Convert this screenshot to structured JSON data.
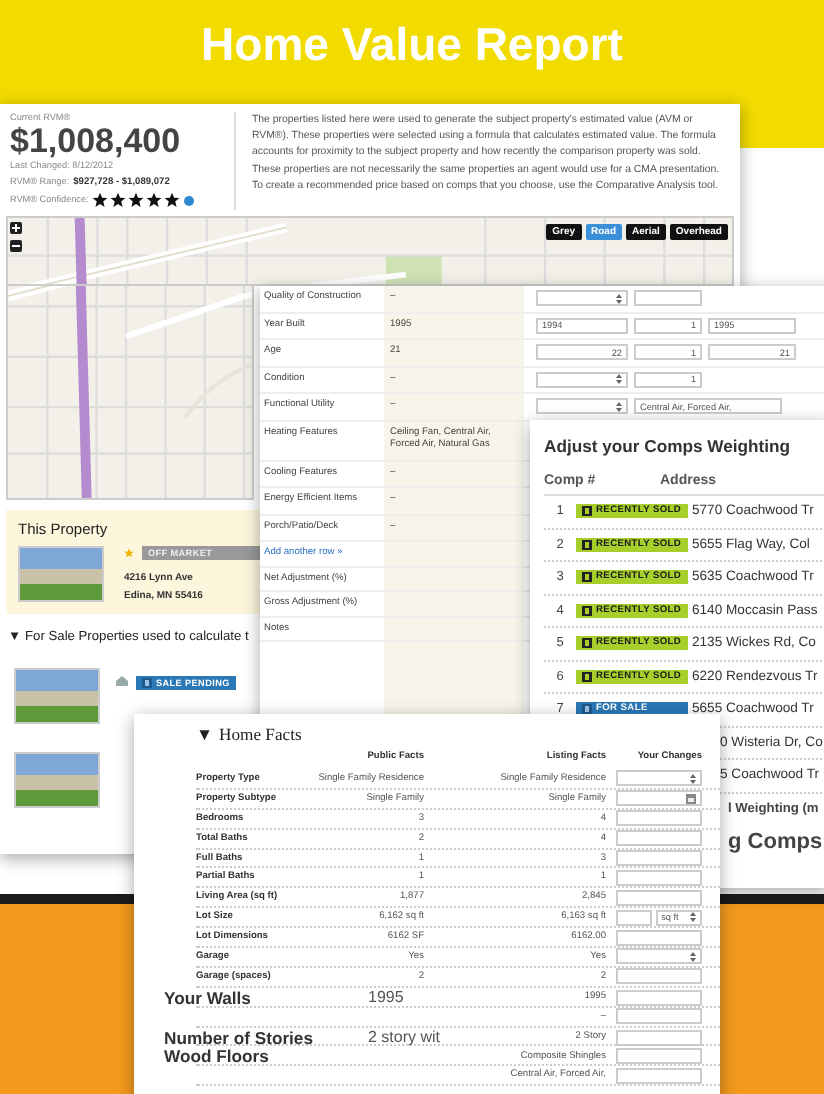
{
  "header": {
    "title": "Home Value Report"
  },
  "rvm_panel": {
    "label": "Current RVM®",
    "value": "$1,008,400",
    "last_changed": "Last Changed: 8/12/2012",
    "range_label": "RVM® Range:",
    "range": "$927,728 - $1,089,072",
    "confidence_label": "RVM® Confidence:",
    "stars": 5,
    "description": "The properties listed here were used to generate the subject property's estimated value (AVM or RVM®). These properties were selected using a formula that calculates estimated value. The formula accounts for proximity to the subject property and how recently the comparison property was sold. These properties are not necessarily the same properties an agent would use for a CMA presentation. To create a recommended price based on comps that you choose, use the Comparative Analysis tool.",
    "map_buttons": [
      {
        "label": "Grey",
        "selected": false
      },
      {
        "label": "Road",
        "selected": true
      },
      {
        "label": "Aerial",
        "selected": false
      },
      {
        "label": "Overhead",
        "selected": false
      }
    ],
    "this_property": {
      "title": "This Property",
      "status": "OFF MARKET",
      "address_line1": "4216 Lynn Ave",
      "address_line2": "Edina, MN 55416"
    },
    "for_sale_heading": {
      "arrow": "▼",
      "text": "For Sale Properties used to calculate t"
    },
    "listings": [
      {
        "kind": "with_status",
        "status": "SALE PENDING"
      },
      {
        "kind": "photo_only"
      }
    ]
  },
  "adjustments": {
    "rows": [
      {
        "label": "Quality of Construction",
        "value": "–",
        "comps": [
          {
            "kind": "select"
          },
          {
            "kind": "input"
          }
        ]
      },
      {
        "label": "Year Built",
        "value": "1995",
        "comps": [
          {
            "kind": "input",
            "value": "1994"
          },
          {
            "kind": "input",
            "value": "1"
          },
          {
            "kind": "input",
            "value": "1995"
          }
        ]
      },
      {
        "label": "Age",
        "value": "21",
        "comps": [
          {
            "kind": "input",
            "value": "22"
          },
          {
            "kind": "input",
            "value": "1"
          },
          {
            "kind": "input",
            "value": "21"
          }
        ]
      },
      {
        "label": "Condition",
        "value": "–",
        "comps": [
          {
            "kind": "select"
          },
          {
            "kind": "input",
            "value": "1"
          }
        ]
      },
      {
        "label": "Functional Utility",
        "value": "–",
        "comps": [
          {
            "kind": "select"
          },
          {
            "kind": "input",
            "value": "Central Air, Forced Air,"
          }
        ]
      },
      {
        "label": "Heating Features",
        "value": "Ceiling Fan, Central Air, Forced Air, Natural Gas"
      },
      {
        "label": "Cooling Features",
        "value": "–"
      },
      {
        "label": "Energy Efficient Items",
        "value": "–"
      },
      {
        "label": "Porch/Patio/Deck",
        "value": "–"
      }
    ],
    "add_row": "Add another row »",
    "summary_rows": [
      "Net Adjustment (%)",
      "Gross Adjustment (%)",
      "Notes"
    ]
  },
  "comps_weighting": {
    "title": "Adjust your Comps Weighting",
    "columns": [
      "Comp #",
      "Address"
    ],
    "rows": [
      {
        "kind": "recently_sold",
        "number": "1",
        "status": "RECENTLY SOLD",
        "address": "5770 Coachwood Tr"
      },
      {
        "kind": "recently_sold",
        "number": "2",
        "status": "RECENTLY SOLD",
        "address": "5655 Flag Way, Col"
      },
      {
        "kind": "recently_sold",
        "number": "3",
        "status": "RECENTLY SOLD",
        "address": "5635 Coachwood Tr"
      },
      {
        "kind": "recently_sold",
        "number": "4",
        "status": "RECENTLY SOLD",
        "address": "6140 Moccasin Pass"
      },
      {
        "kind": "recently_sold",
        "number": "5",
        "status": "RECENTLY SOLD",
        "address": "2135 Wickes Rd, Co"
      },
      {
        "kind": "recently_sold",
        "number": "6",
        "status": "RECENTLY SOLD",
        "address": "6220 Rendezvous Tr"
      },
      {
        "kind": "for_sale",
        "number": "7",
        "status": "FOR SALE",
        "address": "5655 Coachwood Tr"
      },
      {
        "kind": "partial",
        "address": "0 Wisteria Dr, Co"
      },
      {
        "kind": "partial",
        "address": "5 Coachwood Tr"
      }
    ],
    "footer_label": "l Weighting (m",
    "footer_title": "g Comps"
  },
  "home_facts": {
    "arrow": "▼",
    "title": "Home Facts",
    "columns": [
      "Public Facts",
      "Listing Facts",
      "Your Changes"
    ],
    "rows": [
      {
        "kind": "normal",
        "label": "Property Type",
        "public": "Single Family Residence",
        "listing": "Single Family Residence",
        "change": {
          "kind": "select"
        }
      },
      {
        "kind": "normal",
        "label": "Property Subtype",
        "public": "Single Family",
        "listing": "Single Family",
        "change": {
          "kind": "picker"
        }
      },
      {
        "kind": "normal",
        "label": "Bedrooms",
        "public": "3",
        "listing": "4",
        "change": {
          "kind": "input"
        }
      },
      {
        "kind": "normal",
        "label": "Total Baths",
        "public": "2",
        "listing": "4",
        "change": {
          "kind": "input"
        }
      },
      {
        "kind": "normal",
        "label": "Full Baths",
        "public": "1",
        "listing": "3",
        "change": {
          "kind": "input"
        }
      },
      {
        "kind": "normal",
        "label": "Partial Baths",
        "public": "1",
        "listing": "1",
        "change": {
          "kind": "input"
        }
      },
      {
        "kind": "normal",
        "label": "Living Area (sq ft)",
        "public": "1,877",
        "listing": "2,845",
        "change": {
          "kind": "input"
        }
      },
      {
        "kind": "normal",
        "label": "Lot Size",
        "public": "6,162 sq ft",
        "listing": "6,163 sq ft",
        "change": {
          "kind": "unit",
          "unit": "sq ft"
        }
      },
      {
        "kind": "normal",
        "label": "Lot Dimensions",
        "public": "6162 SF",
        "listing": "6162.00",
        "change": {
          "kind": "input"
        }
      },
      {
        "kind": "normal",
        "label": "Garage",
        "public": "Yes",
        "listing": "Yes",
        "change": {
          "kind": "select"
        }
      },
      {
        "kind": "normal",
        "label": "Garage (spaces)",
        "public": "2",
        "listing": "2",
        "change": {
          "kind": "input"
        }
      },
      {
        "kind": "large",
        "label": "Your Walls",
        "public": "1995",
        "listing": "1995",
        "change": {
          "kind": "input"
        }
      },
      {
        "kind": "large",
        "listing": "–",
        "change": {
          "kind": "input"
        }
      },
      {
        "kind": "large",
        "label": "Number of Stories",
        "public": "2 story wit",
        "listing": "2 Story",
        "change": {
          "kind": "input"
        }
      },
      {
        "kind": "large",
        "label": "Wood Floors",
        "listing": "Composite Shingles",
        "change": {
          "kind": "input"
        }
      },
      {
        "kind": "large",
        "listing": "Central Air, Forced Air,",
        "change": {
          "kind": "input"
        }
      }
    ]
  }
}
